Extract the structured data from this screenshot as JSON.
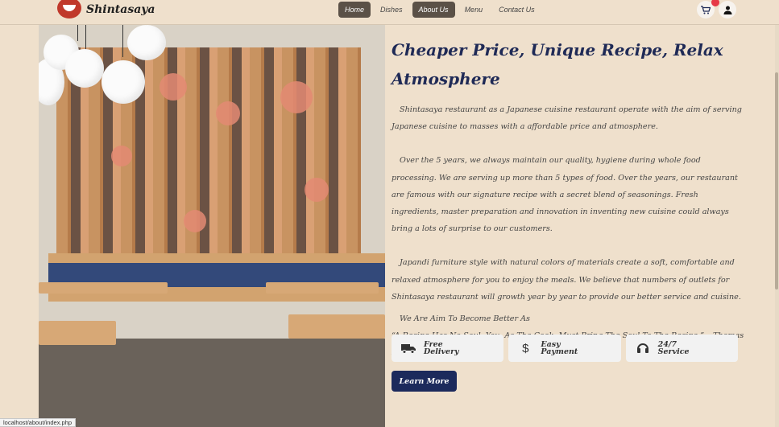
{
  "brand": {
    "name": "Shintasaya"
  },
  "nav": {
    "items": [
      {
        "label": "Home",
        "active": true
      },
      {
        "label": "Dishes",
        "active": false
      },
      {
        "label": "About Us",
        "active": true
      },
      {
        "label": "Menu",
        "active": false
      },
      {
        "label": "Contact Us",
        "active": false
      }
    ]
  },
  "header_icons": {
    "cart": "cart-icon",
    "user": "user-icon"
  },
  "about": {
    "title": "Cheaper Price, Unique Recipe, Relax Atmosphere",
    "paragraphs": [
      "Shintasaya restaurant as a Japanese cuisine restaurant operate with the aim of serving Japanese cuisine to masses with a affordable price and atmosphere.",
      "Over the 5 years, we always maintain our quality, hygiene during whole food processing. We are serving up more than 5 types of food. Over the years, our restaurant are famous with our signature recipe with a secret blend of seasonings. Fresh ingredients, master preparation and innovation in inventing new cuisine could always bring a lots of surprise to our customers.",
      "Japandi furniture style with natural colors of materials create a soft, comfortable and relaxed atmosphere for you to enjoy the meals. We believe that numbers of outlets for Shintasaya restaurant will growth year by year to provide our better service and cuisine."
    ],
    "aim": "We Are Aim To Become Better As",
    "quote": "“A Recipe Has No Soul. You, As The Cook, Must Bring The Soul To The Recipe.” – Thomas Keller"
  },
  "features": [
    {
      "label": "Free\nDelivery",
      "icon": "truck-icon"
    },
    {
      "label": "Easy\nPayment",
      "icon": "dollar-icon"
    },
    {
      "label": "24/7\nService",
      "icon": "headset-icon"
    }
  ],
  "cta": {
    "label": "Learn More"
  },
  "status_bar": {
    "url": "localhost/about/index.php"
  },
  "colors": {
    "background": "#efe0cc",
    "accent": "#1c2a5c",
    "nav_active": "#5b5147"
  }
}
